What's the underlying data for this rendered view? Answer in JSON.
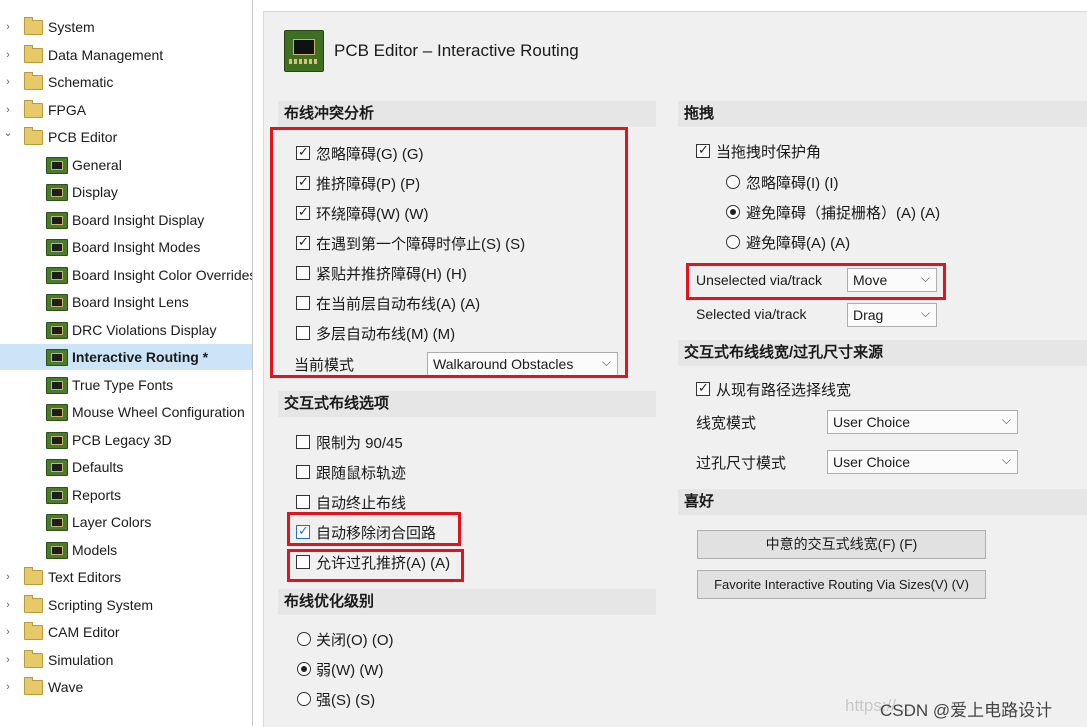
{
  "tree": {
    "items": [
      {
        "label": "System",
        "kind": "folder",
        "expanded": false
      },
      {
        "label": "Data Management",
        "kind": "folder",
        "expanded": false
      },
      {
        "label": "Schematic",
        "kind": "folder",
        "expanded": false
      },
      {
        "label": "FPGA",
        "kind": "folder",
        "expanded": false
      },
      {
        "label": "PCB Editor",
        "kind": "folder",
        "expanded": true
      },
      {
        "label": "General",
        "kind": "pcb"
      },
      {
        "label": "Display",
        "kind": "pcb"
      },
      {
        "label": "Board Insight Display",
        "kind": "pcb"
      },
      {
        "label": "Board Insight Modes",
        "kind": "pcb"
      },
      {
        "label": "Board Insight Color Overrides",
        "kind": "pcb"
      },
      {
        "label": "Board Insight Lens",
        "kind": "pcb"
      },
      {
        "label": "DRC Violations Display",
        "kind": "pcb"
      },
      {
        "label": "Interactive Routing *",
        "kind": "pcb",
        "selected": true
      },
      {
        "label": "True Type Fonts",
        "kind": "pcb"
      },
      {
        "label": "Mouse Wheel Configuration",
        "kind": "pcb"
      },
      {
        "label": "PCB Legacy 3D",
        "kind": "pcb"
      },
      {
        "label": "Defaults",
        "kind": "pcb"
      },
      {
        "label": "Reports",
        "kind": "pcb"
      },
      {
        "label": "Layer Colors",
        "kind": "pcb"
      },
      {
        "label": "Models",
        "kind": "pcb"
      },
      {
        "label": "Text Editors",
        "kind": "folder",
        "expanded": false
      },
      {
        "label": "Scripting System",
        "kind": "folder",
        "expanded": false
      },
      {
        "label": "CAM Editor",
        "kind": "folder",
        "expanded": false
      },
      {
        "label": "Simulation",
        "kind": "folder",
        "expanded": false
      },
      {
        "label": "Wave",
        "kind": "folder",
        "expanded": false
      }
    ]
  },
  "header": {
    "title": "PCB Editor – Interactive Routing"
  },
  "conflict": {
    "title": "布线冲突分析",
    "options": [
      {
        "label": "忽略障碍(G) (G)",
        "checked": true
      },
      {
        "label": "推挤障碍(P) (P)",
        "checked": true
      },
      {
        "label": "环绕障碍(W) (W)",
        "checked": true
      },
      {
        "label": "在遇到第一个障碍时停止(S) (S)",
        "checked": true
      },
      {
        "label": "紧贴并推挤障碍(H) (H)",
        "checked": false
      },
      {
        "label": "在当前层自动布线(A) (A)",
        "checked": false
      },
      {
        "label": "多层自动布线(M) (M)",
        "checked": false
      }
    ],
    "mode_label": "当前模式",
    "mode_value": "Walkaround Obstacles"
  },
  "routing_options": {
    "title": "交互式布线选项",
    "options": [
      {
        "label": "限制为 90/45",
        "checked": false
      },
      {
        "label": "跟随鼠标轨迹",
        "checked": false
      },
      {
        "label": "自动终止布线",
        "checked": false
      },
      {
        "label": "自动移除闭合回路",
        "checked": true
      },
      {
        "label": "允许过孔推挤(A) (A)",
        "checked": false
      }
    ]
  },
  "optimization": {
    "title": "布线优化级别",
    "options": [
      {
        "label": "关闭(O) (O)",
        "selected": false
      },
      {
        "label": "弱(W) (W)",
        "selected": true
      },
      {
        "label": "强(S) (S)",
        "selected": false
      }
    ]
  },
  "drag": {
    "title": "拖拽",
    "preserve_label": "当拖拽时保护角",
    "preserve_checked": true,
    "radios": [
      {
        "label": "忽略障碍(I) (I)",
        "selected": false
      },
      {
        "label": "避免障碍（捕捉栅格）(A) (A)",
        "selected": true
      },
      {
        "label": "避免障碍(A) (A)",
        "selected": false
      }
    ],
    "unselected_label": "Unselected via/track",
    "unselected_value": "Move",
    "selected_label": "Selected via/track",
    "selected_value": "Drag"
  },
  "width_source": {
    "title": "交互式布线线宽/过孔尺寸来源",
    "pick_label": "从现有路径选择线宽",
    "pick_checked": true,
    "width_mode_label": "线宽模式",
    "width_mode_value": "User Choice",
    "via_mode_label": "过孔尺寸模式",
    "via_mode_value": "User Choice"
  },
  "favorites": {
    "title": "喜好",
    "btn1": "中意的交互式线宽(F) (F)",
    "btn2": "Favorite Interactive Routing Via Sizes(V) (V)"
  },
  "watermark": {
    "left": "https://...",
    "right": "CSDN @爱上电路设计"
  },
  "colors": {
    "highlight": "#e0141e",
    "selection": "#cce4f7",
    "panel": "#f0f0f0",
    "section": "#e6e6e6"
  }
}
